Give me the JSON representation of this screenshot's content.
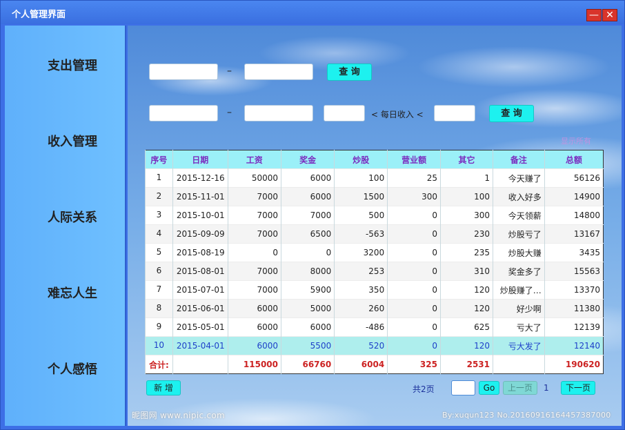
{
  "window": {
    "title": "个人管理界面",
    "minimize_label": "—",
    "close_label": "✕"
  },
  "sidebar": {
    "items": [
      {
        "label": "支出管理"
      },
      {
        "label": "收入管理"
      },
      {
        "label": "人际关系"
      },
      {
        "label": "难忘人生"
      },
      {
        "label": "个人感悟"
      }
    ]
  },
  "filters": {
    "date_range_sep": "–",
    "query_label": "查 询",
    "income_daily_label": "< 每日收入 <",
    "faint_link": "显示所有"
  },
  "table": {
    "headers": [
      "序号",
      "日期",
      "工资",
      "奖金",
      "炒股",
      "营业额",
      "其它",
      "备注",
      "总额"
    ],
    "rows": [
      [
        "1",
        "2015-12-16",
        "50000",
        "6000",
        "100",
        "25",
        "1",
        "今天赚了",
        "56126"
      ],
      [
        "2",
        "2015-11-01",
        "7000",
        "6000",
        "1500",
        "300",
        "100",
        "收入好多",
        "14900"
      ],
      [
        "3",
        "2015-10-01",
        "7000",
        "7000",
        "500",
        "0",
        "300",
        "今天领薪",
        "14800"
      ],
      [
        "4",
        "2015-09-09",
        "7000",
        "6500",
        "-563",
        "0",
        "230",
        "炒股亏了",
        "13167"
      ],
      [
        "5",
        "2015-08-19",
        "0",
        "0",
        "3200",
        "0",
        "235",
        "炒股大赚",
        "3435"
      ],
      [
        "6",
        "2015-08-01",
        "7000",
        "8000",
        "253",
        "0",
        "310",
        "奖金多了",
        "15563"
      ],
      [
        "7",
        "2015-07-01",
        "7000",
        "5900",
        "350",
        "0",
        "120",
        "炒股赚了…",
        "13370"
      ],
      [
        "8",
        "2015-06-01",
        "6000",
        "5000",
        "260",
        "0",
        "120",
        "好少啊",
        "11380"
      ],
      [
        "9",
        "2015-05-01",
        "6000",
        "6000",
        "-486",
        "0",
        "625",
        "亏大了",
        "12139"
      ],
      [
        "10",
        "2015-04-01",
        "6000",
        "5500",
        "520",
        "0",
        "120",
        "亏大发了",
        "12140"
      ]
    ],
    "selected_row_index": 9,
    "total": [
      "合计:",
      "",
      "115000",
      "66760",
      "6004",
      "325",
      "2531",
      "",
      "190620"
    ]
  },
  "footer": {
    "add_label": "新 增",
    "total_pages": "共2页",
    "go_label": "Go",
    "prev_label": "上一页",
    "current_page": "1",
    "next_label": "下一页",
    "watermark_left": "昵图网 www.nipic.com",
    "watermark_right": "By:xuqun123 No.20160916164457387000"
  },
  "colors": {
    "accent": "#1df1ef",
    "header_bg": "#9bf0f8",
    "header_text": "#7b2bbf",
    "total_text": "#cc2222",
    "selected_row": "#aeeeed"
  }
}
